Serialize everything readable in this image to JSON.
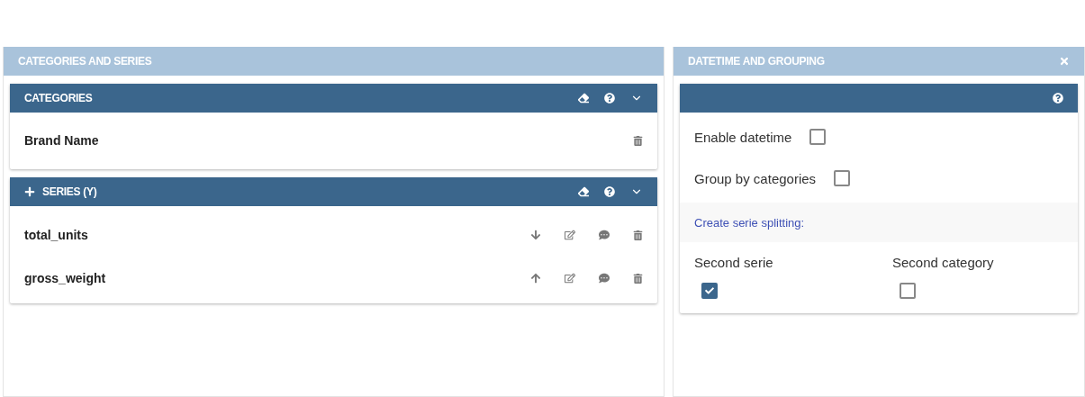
{
  "left_panel": {
    "title": "CATEGORIES AND SERIES",
    "categories": {
      "title": "CATEGORIES",
      "items": [
        {
          "label": "Brand Name"
        }
      ]
    },
    "series": {
      "title": "SERIES (Y)",
      "items": [
        {
          "label": "total_units",
          "kind": "down"
        },
        {
          "label": "gross_weight",
          "kind": "up"
        }
      ]
    }
  },
  "right_panel": {
    "title": "DATETIME AND GROUPING",
    "options": [
      {
        "label": "Enable datetime",
        "checked": false
      },
      {
        "label": "Group by categories",
        "checked": false
      }
    ],
    "splitting_title": "Create serie splitting:",
    "splitting": [
      {
        "label": "Second serie",
        "checked": true
      },
      {
        "label": "Second category",
        "checked": false
      }
    ]
  }
}
